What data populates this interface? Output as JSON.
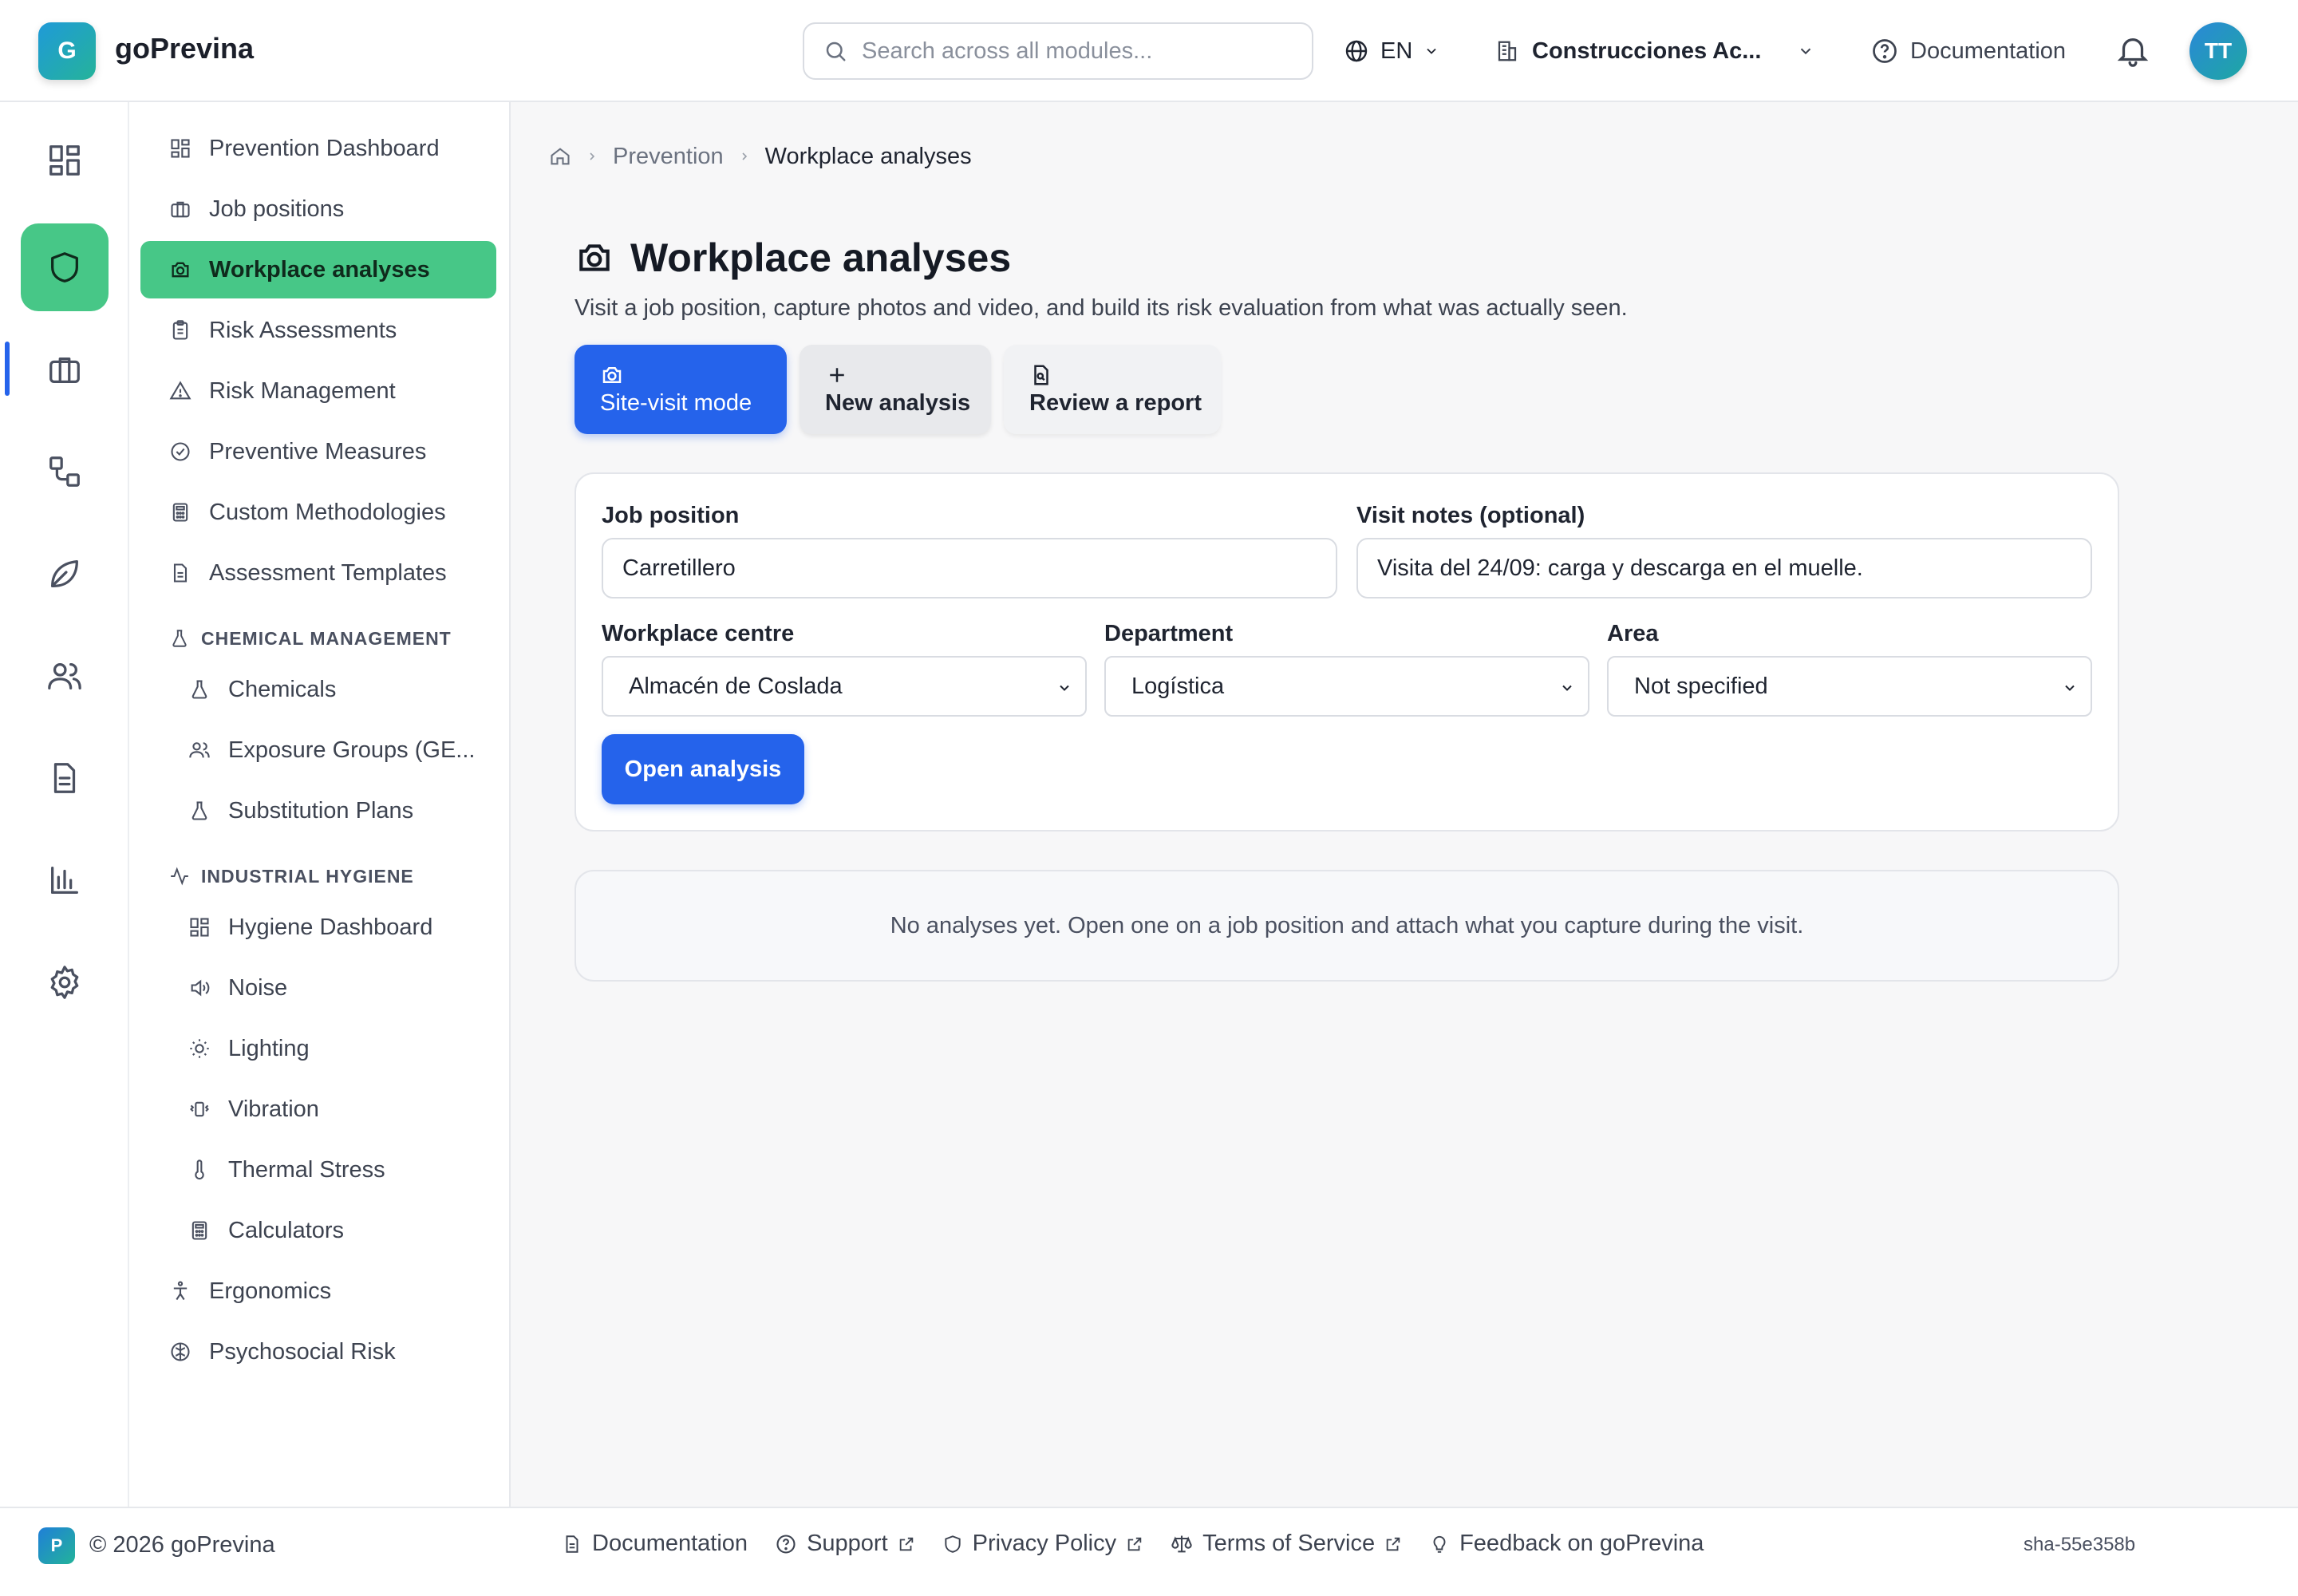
{
  "app": {
    "logo_letter": "G",
    "name": "goPrevina"
  },
  "topbar": {
    "search_placeholder": "Search across all modules...",
    "language": "EN",
    "company": "Construcciones Ac...",
    "documentation": "Documentation",
    "avatar_initials": "TT"
  },
  "rail": {
    "items": [
      {
        "icon": "dashboard-grid-icon",
        "active": false
      },
      {
        "icon": "shield-icon",
        "active": true
      },
      {
        "icon": "briefcase-icon",
        "active": false
      },
      {
        "icon": "workflow-icon",
        "active": false
      },
      {
        "icon": "leaf-icon",
        "active": false
      },
      {
        "icon": "users-icon",
        "active": false
      },
      {
        "icon": "document-icon",
        "active": false
      },
      {
        "icon": "bar-chart-icon",
        "active": false
      },
      {
        "icon": "gear-icon",
        "active": false
      }
    ]
  },
  "sidebar": {
    "items": [
      {
        "label": "Prevention Dashboard",
        "icon": "dashboard-grid-icon"
      },
      {
        "label": "Job positions",
        "icon": "briefcase-icon"
      },
      {
        "label": "Workplace analyses",
        "icon": "camera-icon",
        "active": true
      },
      {
        "label": "Risk Assessments",
        "icon": "clipboard-icon"
      },
      {
        "label": "Risk Management",
        "icon": "warning-triangle-icon"
      },
      {
        "label": "Preventive Measures",
        "icon": "check-circle-icon"
      },
      {
        "label": "Custom Methodologies",
        "icon": "calculator-icon"
      },
      {
        "label": "Assessment Templates",
        "icon": "file-text-icon"
      }
    ],
    "chemical_section": "CHEMICAL MANAGEMENT",
    "chemical_items": [
      {
        "label": "Chemicals",
        "icon": "flask-icon"
      },
      {
        "label": "Exposure Groups (GE...",
        "icon": "users-icon"
      },
      {
        "label": "Substitution Plans",
        "icon": "flask-icon"
      }
    ],
    "hygiene_section": "INDUSTRIAL HYGIENE",
    "hygiene_items": [
      {
        "label": "Hygiene Dashboard",
        "icon": "dashboard-grid-icon"
      },
      {
        "label": "Noise",
        "icon": "speaker-icon"
      },
      {
        "label": "Lighting",
        "icon": "sun-icon"
      },
      {
        "label": "Vibration",
        "icon": "vibration-icon"
      },
      {
        "label": "Thermal Stress",
        "icon": "thermometer-icon"
      },
      {
        "label": "Calculators",
        "icon": "calculator-icon"
      }
    ],
    "bottom_items": [
      {
        "label": "Ergonomics",
        "icon": "person-icon"
      },
      {
        "label": "Psychosocial Risk",
        "icon": "brain-icon"
      }
    ]
  },
  "breadcrumb": {
    "section": "Prevention",
    "current": "Workplace analyses"
  },
  "page": {
    "title": "Workplace analyses",
    "subtitle": "Visit a job position, capture photos and video, and build its risk evaluation from what was actually seen."
  },
  "modes": {
    "site_visit": "Site-visit mode",
    "new_analysis": "New analysis",
    "review_report": "Review a report"
  },
  "form": {
    "job_position_label": "Job position",
    "job_position_value": "Carretillero",
    "visit_notes_label": "Visit notes (optional)",
    "visit_notes_value": "Visita del 24/09: carga y descarga en el muelle.",
    "workplace_centre_label": "Workplace centre",
    "workplace_centre_value": "Almacén de Coslada",
    "department_label": "Department",
    "department_value": "Logística",
    "area_label": "Area",
    "area_value": "Not specified",
    "open_button": "Open analysis"
  },
  "empty_state": "No analyses yet. Open one on a job position and attach what you capture during the visit.",
  "footer": {
    "logo_letter": "P",
    "copyright": "© 2026 goPrevina",
    "links": {
      "documentation": "Documentation",
      "support": "Support",
      "privacy": "Privacy Policy",
      "terms": "Terms of Service",
      "feedback": "Feedback on goPrevina"
    },
    "sha": "sha-55e358b"
  },
  "colors": {
    "accent_blue": "#2563eb",
    "active_green": "#47c787"
  }
}
